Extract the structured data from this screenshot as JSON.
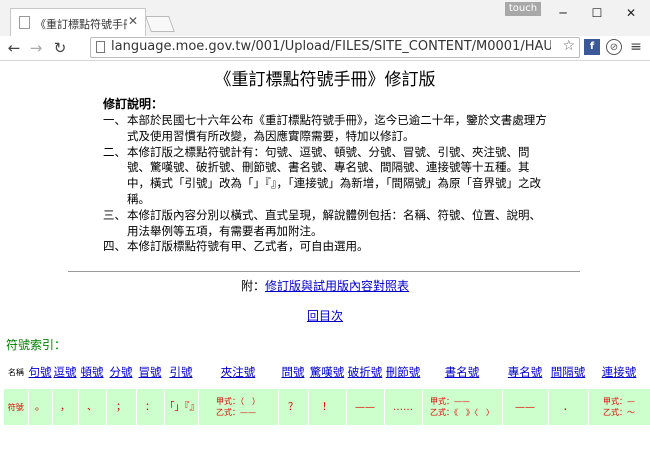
{
  "browser": {
    "tab_title": "《重訂標點符號手冊》修訂",
    "touch_label": "touch",
    "url": "language.moe.gov.tw/001/Upload/FILES/SITE_CONTENT/M0001/HAU/haush"
  },
  "page": {
    "title": "《重訂標點符號手冊》修訂版",
    "intro_heading": "修訂說明：",
    "items": [
      {
        "num": "一、",
        "text": "本部於民國七十六年公布《重訂標點符號手冊》，迄今已逾二十年，鑒於文書處理方式及使用習慣有所改變，為因應實際需要，特加以修訂。"
      },
      {
        "num": "二、",
        "text": "本修訂版之標點符號計有：句號、逗號、頓號、分號、冒號、引號、夾注號、問號、驚嘆號、破折號、刪節號、書名號、專名號、間隔號、連接號等十五種。其中，橫式「引號」改為「」『』，「連接號」為新增，「間隔號」為原「音界號」之改稱。"
      },
      {
        "num": "三、",
        "text": "本修訂版內容分別以橫式、直式呈現，解說體例包括：名稱、符號、位置、說明、用法舉例等五項，有需要者再加附注。"
      },
      {
        "num": "四、",
        "text": "本修訂版標點符號有甲、乙式者，可自由選用。"
      }
    ],
    "appendix_prefix": "附：",
    "appendix_link": "修訂版與試用版內容對照表",
    "back_link": "回目次",
    "index_label": "符號索引："
  },
  "index": {
    "name_row_label": "名稱",
    "symbol_row_label": "符號",
    "names": [
      "句號",
      "逗號",
      "頓號",
      "分號",
      "冒號",
      "引號",
      "夾注號",
      "問號",
      "驚嘆號",
      "破折號",
      "刪節號",
      "書名號",
      "專名號",
      "間隔號",
      "連接號"
    ],
    "symbols": {
      "period": "。",
      "comma": "，",
      "enum_comma": "、",
      "semicolon": "；",
      "colon": "：",
      "quote": "「」『』",
      "paren_a": "甲式：（　）",
      "paren_b": "乙式：——",
      "question": "？",
      "exclaim": "！",
      "dash": "——",
      "ellipsis": "……",
      "book_a": "甲式：——",
      "book_b": "乙式：《　》〈　〉",
      "proper": "——",
      "interpunct": "．",
      "connector_a": "甲式：—",
      "connector_b": "乙式：～"
    }
  }
}
